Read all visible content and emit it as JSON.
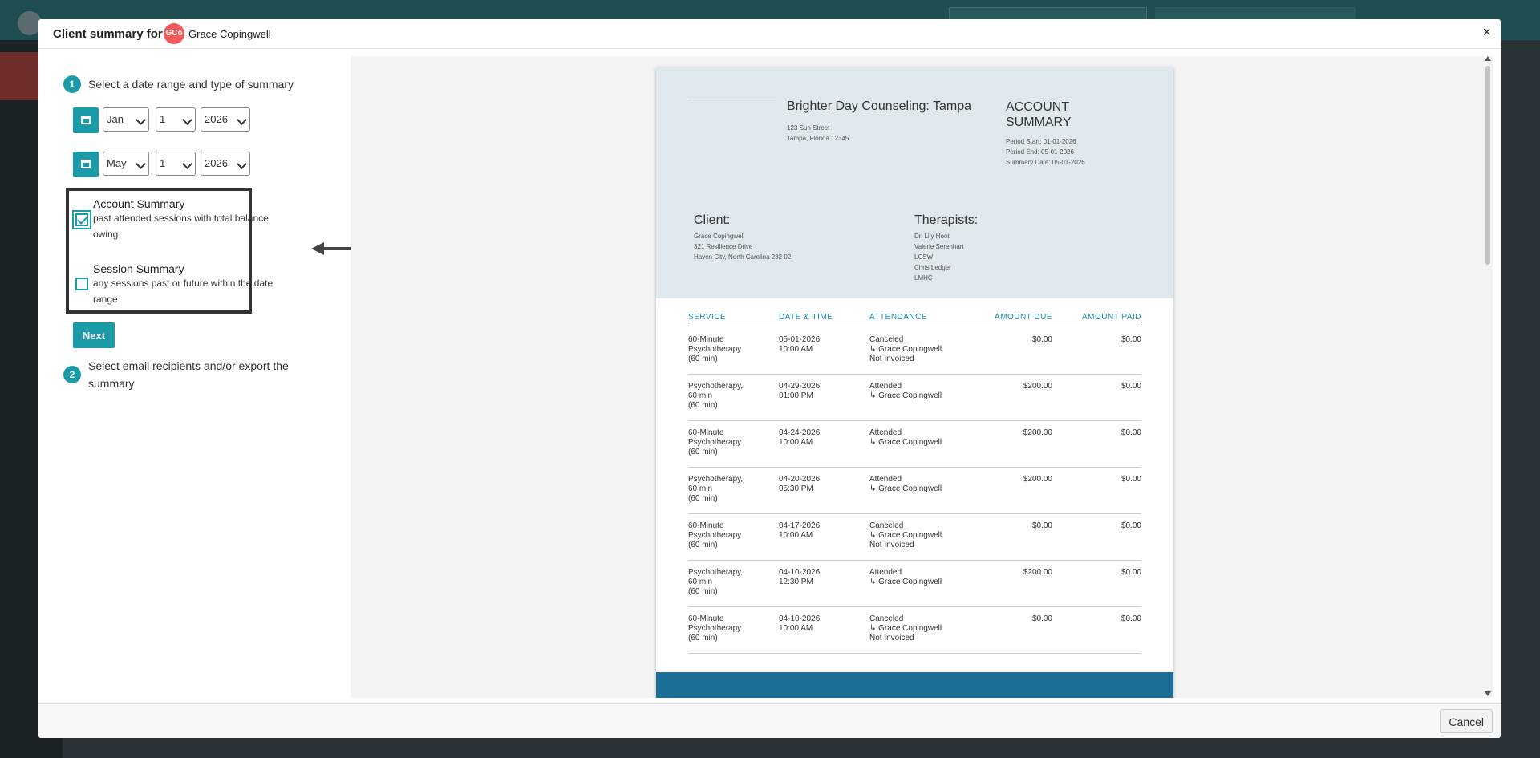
{
  "modal": {
    "title_prefix": "Client summary for",
    "client_initials": "GCo",
    "client_name": "Grace Copingwell",
    "close_glyph": "×",
    "cancel_label": "Cancel"
  },
  "step1": {
    "number": "1",
    "label": "Select a date range and type of summary",
    "start": {
      "month": "Jan",
      "day": "1",
      "year": "2026"
    },
    "end": {
      "month": "May",
      "day": "1",
      "year": "2026"
    },
    "options": [
      {
        "title": "Account Summary",
        "description": "past attended sessions with total balance owing",
        "checked": true
      },
      {
        "title": "Session Summary",
        "description": "any sessions past or future within the date range",
        "checked": false
      }
    ],
    "next_label": "Next"
  },
  "step2": {
    "number": "2",
    "label": "Select email recipients and/or export the summary"
  },
  "document": {
    "practice_name": "Brighter Day Counseling: Tampa",
    "practice_address_1": "123 Sun Street",
    "practice_address_2": "Tampa, Florida 12345",
    "summary_title": "ACCOUNT SUMMARY",
    "period_start": "Period Start: 01-01-2026",
    "period_end": "Period End: 05-01-2026",
    "summary_date": "Summary Date: 05-01-2026",
    "client_heading": "Client:",
    "client_name": "Grace Copingwell",
    "client_address_1": "321 Resilience Drive",
    "client_address_2": "Haven City, North Carolina 282 02",
    "therapists_heading": "Therapists:",
    "therapists": [
      "Dr. Lily Hoot",
      "Valerie Serenhart",
      "LCSW",
      "Chris Ledger",
      "LMHC"
    ],
    "columns": [
      "SERVICE",
      "DATE & TIME",
      "ATTENDANCE",
      "AMOUNT DUE",
      "AMOUNT PAID"
    ],
    "rows": [
      {
        "service": [
          "60-Minute",
          "Psychotherapy",
          "(60 min)"
        ],
        "date": "05-01-2026",
        "time": "10:00 AM",
        "attendance": [
          "Canceled",
          "↳ Grace Copingwell",
          "Not Invoiced"
        ],
        "due": "$0.00",
        "paid": "$0.00"
      },
      {
        "service": [
          "Psychotherapy,",
          "60 min",
          "(60 min)"
        ],
        "date": "04-29-2026",
        "time": "01:00 PM",
        "attendance": [
          "Attended",
          "↳ Grace Copingwell",
          ""
        ],
        "due": "$200.00",
        "paid": "$0.00"
      },
      {
        "service": [
          "60-Minute",
          "Psychotherapy",
          "(60 min)"
        ],
        "date": "04-24-2026",
        "time": "10:00 AM",
        "attendance": [
          "Attended",
          "↳ Grace Copingwell",
          ""
        ],
        "due": "$200.00",
        "paid": "$0.00"
      },
      {
        "service": [
          "Psychotherapy,",
          "60 min",
          "(60 min)"
        ],
        "date": "04-20-2026",
        "time": "05:30 PM",
        "attendance": [
          "Attended",
          "↳ Grace Copingwell",
          ""
        ],
        "due": "$200.00",
        "paid": "$0.00"
      },
      {
        "service": [
          "60-Minute",
          "Psychotherapy",
          "(60 min)"
        ],
        "date": "04-17-2026",
        "time": "10:00 AM",
        "attendance": [
          "Canceled",
          "↳ Grace Copingwell",
          "Not Invoiced"
        ],
        "due": "$0.00",
        "paid": "$0.00"
      },
      {
        "service": [
          "Psychotherapy,",
          "60 min",
          "(60 min)"
        ],
        "date": "04-10-2026",
        "time": "12:30 PM",
        "attendance": [
          "Attended",
          "↳ Grace Copingwell",
          ""
        ],
        "due": "$200.00",
        "paid": "$0.00"
      },
      {
        "service": [
          "60-Minute",
          "Psychotherapy",
          "(60 min)"
        ],
        "date": "04-10-2026",
        "time": "10:00 AM",
        "attendance": [
          "Canceled",
          "↳ Grace Copingwell",
          "Not Invoiced"
        ],
        "due": "$0.00",
        "paid": "$0.00"
      }
    ]
  },
  "colors": {
    "accent": "#1b9aa8",
    "avatar": "#f05a5a",
    "doc_header_bg": "#dfe8ec",
    "doc_footer_bar": "#1b6f96"
  },
  "icons": [
    "close-icon",
    "calendar-icon",
    "chevron-down-icon",
    "checkbox-icon",
    "arrow-left-icon"
  ]
}
